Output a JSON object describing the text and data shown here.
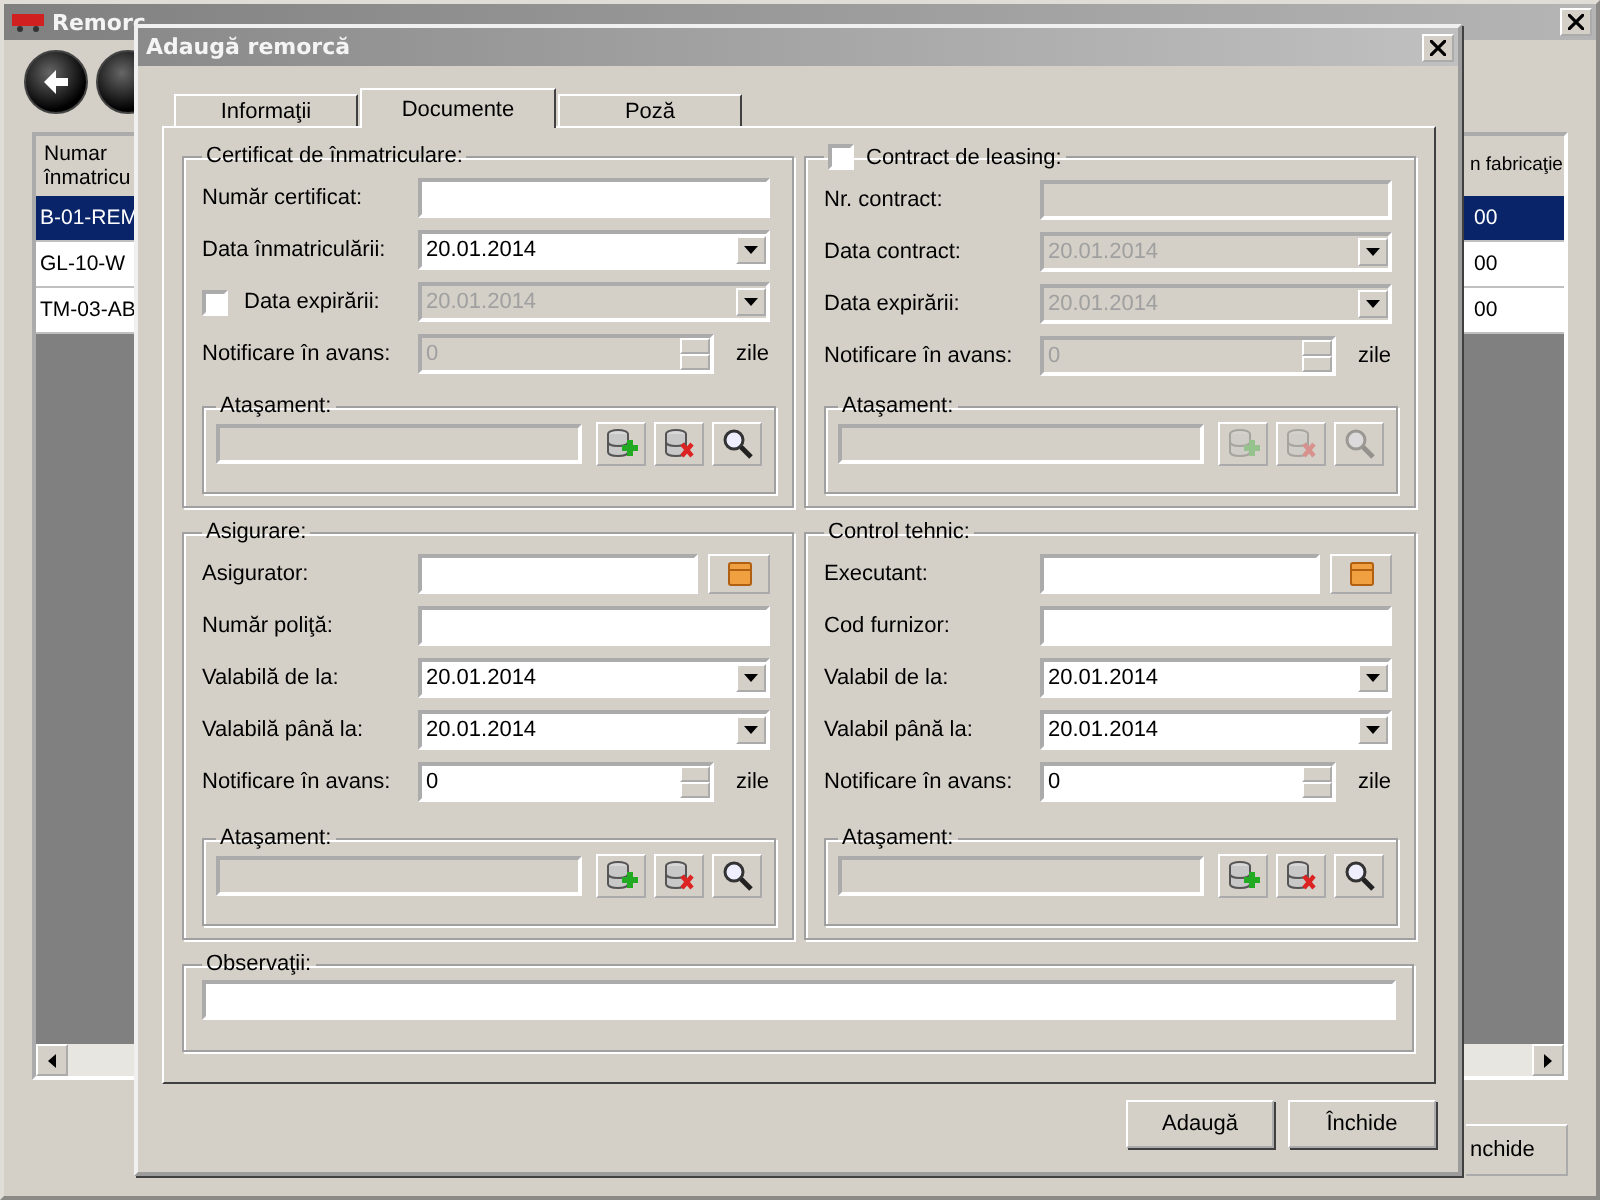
{
  "background_window": {
    "title": "Remorc",
    "table": {
      "columns": [
        "Numar înmatricu",
        "n fabricaţie"
      ],
      "rows": [
        {
          "cells": [
            "B-01-REM",
            "00"
          ],
          "selected": true
        },
        {
          "cells": [
            "GL-10-W",
            "00"
          ],
          "selected": false
        },
        {
          "cells": [
            "TM-03-AB",
            "00"
          ],
          "selected": false
        }
      ]
    },
    "button": "nchide"
  },
  "dialog": {
    "title": "Adaugă remorcă",
    "tabs": [
      {
        "label": "Informaţii",
        "selected": false
      },
      {
        "label": "Documente",
        "selected": true
      },
      {
        "label": "Poză",
        "selected": false
      }
    ],
    "groups": [
      {
        "title": "Certificat de înmatriculare:",
        "kind": "plain",
        "rows": [
          {
            "kind": "text",
            "label": "Număr certificat:",
            "disabled": false
          },
          {
            "kind": "date",
            "label": "Data înmatriculării:",
            "value": "20.01.2014",
            "disabled": false
          },
          {
            "kind": "check-date",
            "label": "Data expirării:",
            "value": "20.01.2014",
            "checked": false,
            "disabled": true
          },
          {
            "kind": "spin",
            "label": "Notificare în avans:",
            "value": "0",
            "unit": "zile",
            "disabled": true
          }
        ],
        "attachment": {
          "label": "Ataşament:",
          "disabled": false
        }
      },
      {
        "title": "Contract de leasing:",
        "kind": "checkbox",
        "checked": false,
        "rows": [
          {
            "kind": "text",
            "label": "Nr. contract:",
            "disabled": true
          },
          {
            "kind": "date",
            "label": "Data contract:",
            "value": "20.01.2014",
            "disabled": true
          },
          {
            "kind": "date",
            "label": "Data expirării:",
            "value": "20.01.2014",
            "disabled": true
          },
          {
            "kind": "spin",
            "label": "Notificare în avans:",
            "value": "0",
            "unit": "zile",
            "disabled": true
          }
        ],
        "attachment": {
          "label": "Ataşament:",
          "disabled": true
        }
      },
      {
        "title": "Asigurare:",
        "kind": "plain",
        "rows": [
          {
            "kind": "lookup",
            "label": "Asigurator:",
            "disabled": false
          },
          {
            "kind": "text",
            "label": "Număr poliţă:",
            "disabled": false
          },
          {
            "kind": "date",
            "label": "Valabilă de la:",
            "value": "20.01.2014",
            "disabled": false
          },
          {
            "kind": "date",
            "label": "Valabilă până la:",
            "value": "20.01.2014",
            "disabled": false
          },
          {
            "kind": "spin",
            "label": "Notificare în avans:",
            "value": "0",
            "unit": "zile",
            "disabled": false
          }
        ],
        "attachment": {
          "label": "Ataşament:",
          "disabled": false
        }
      },
      {
        "title": "Control tehnic:",
        "kind": "plain",
        "rows": [
          {
            "kind": "lookup",
            "label": "Executant:",
            "disabled": false
          },
          {
            "kind": "text",
            "label": "Cod furnizor:",
            "disabled": false
          },
          {
            "kind": "date",
            "label": "Valabil de la:",
            "value": "20.01.2014",
            "disabled": false
          },
          {
            "kind": "date",
            "label": "Valabil până la:",
            "value": "20.01.2014",
            "disabled": false
          },
          {
            "kind": "spin",
            "label": "Notificare în avans:",
            "value": "0",
            "unit": "zile",
            "disabled": false
          }
        ],
        "attachment": {
          "label": "Ataşament:",
          "disabled": false
        }
      }
    ],
    "observations": {
      "label": "Observaţii:"
    },
    "buttons": [
      "Adaugă",
      "Închide"
    ]
  }
}
